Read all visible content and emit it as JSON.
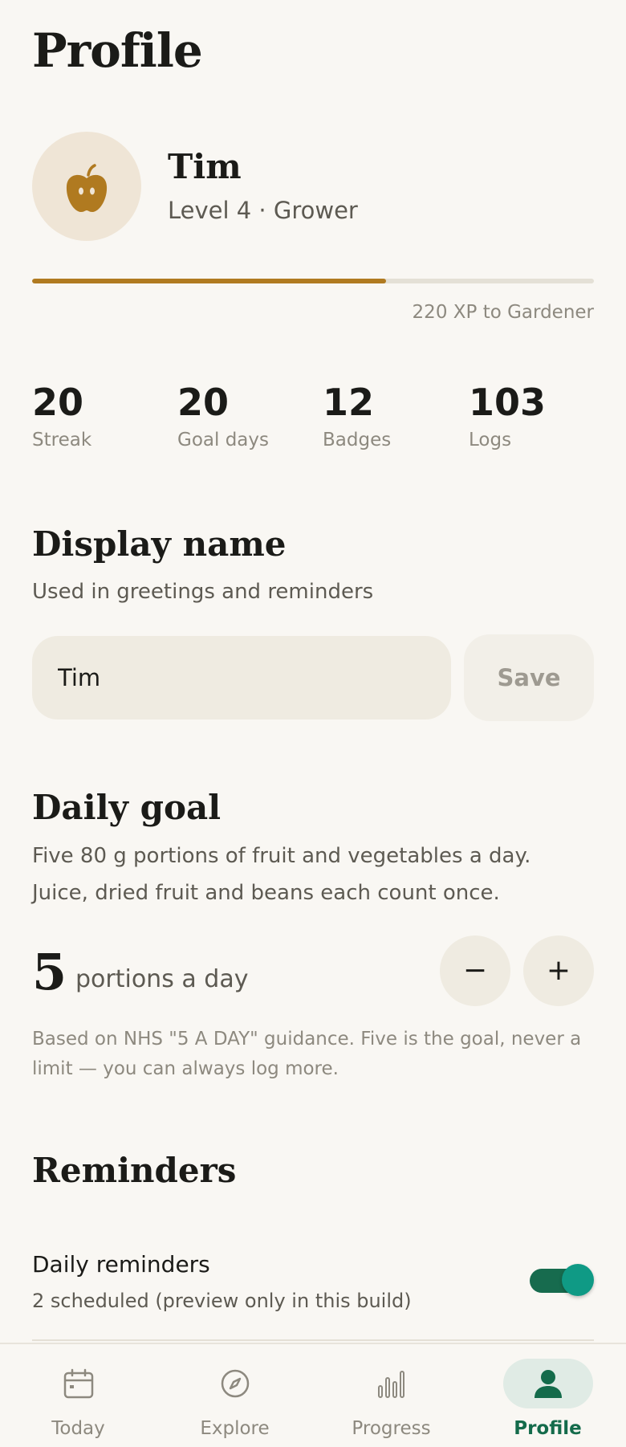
{
  "header": {
    "title": "Profile"
  },
  "user": {
    "name": "Tim",
    "level_text": "Level 4 · Grower",
    "avatar_icon": "apple-icon",
    "xp_progress": 0.63,
    "xp_caption": "220 XP to Gardener"
  },
  "stats": [
    {
      "value": "20",
      "label": "Streak"
    },
    {
      "value": "20",
      "label": "Goal days"
    },
    {
      "value": "12",
      "label": "Badges"
    },
    {
      "value": "103",
      "label": "Logs"
    }
  ],
  "display_name": {
    "title": "Display name",
    "subtitle": "Used in greetings and reminders",
    "input_value": "Tim",
    "save_label": "Save"
  },
  "daily_goal": {
    "title": "Daily goal",
    "description_line1": "Five 80 g portions of fruit and vegetables a day.",
    "description_line2": "Juice, dried fruit and beans each count once.",
    "value": "5",
    "unit": "portions a day",
    "decrement_label": "−",
    "increment_label": "+",
    "note": "Based on NHS \"5 A DAY\" guidance. Five is the goal, never a limit — you can always log more."
  },
  "reminders": {
    "title": "Reminders",
    "item_title": "Daily reminders",
    "item_subtitle": "2 scheduled (preview only in this build)",
    "enabled": true
  },
  "tabbar": {
    "tabs": [
      {
        "label": "Today",
        "icon": "calendar-icon"
      },
      {
        "label": "Explore",
        "icon": "compass-icon"
      },
      {
        "label": "Progress",
        "icon": "bar-chart-icon"
      },
      {
        "label": "Profile",
        "icon": "person-icon",
        "active": true
      }
    ]
  },
  "colors": {
    "accent": "#146b4b",
    "progress": "#b07a20",
    "background": "#f9f7f3"
  }
}
